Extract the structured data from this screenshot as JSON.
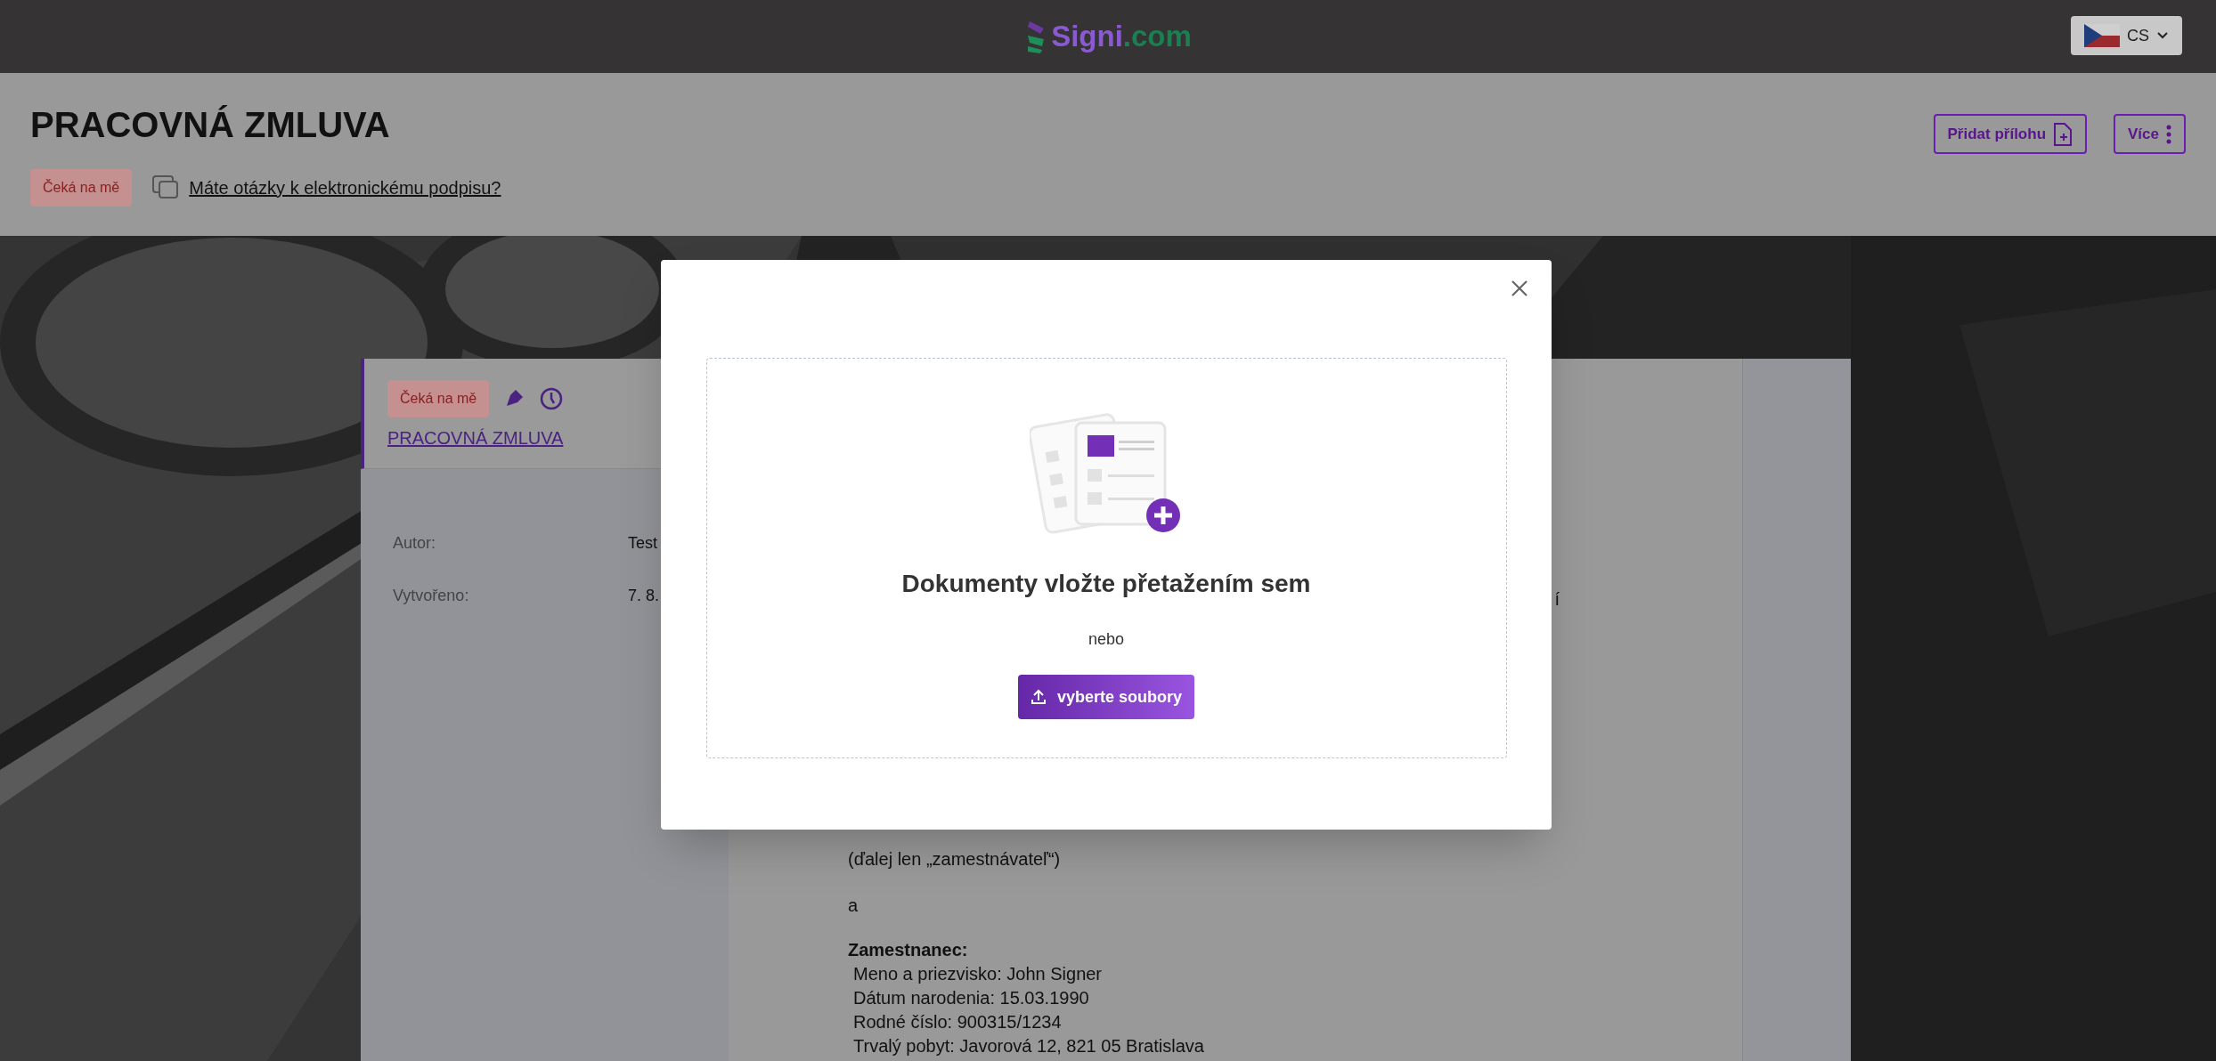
{
  "topbar": {
    "logo": {
      "name": "Signi",
      "suffix": ".com"
    },
    "language": {
      "code": "CS"
    }
  },
  "header": {
    "title": "PRACOVNÁ ZMLUVA",
    "status_badge": "Čeká na mě",
    "help_link": "Máte otázky k elektronickému podpisu?",
    "buttons": [
      {
        "label": "Přidat přílohu"
      },
      {
        "label": "Více"
      }
    ]
  },
  "document": {
    "status_badge": "Čeká na mě",
    "title_link": "PRACOVNÁ ZMLUVA",
    "details": [
      {
        "label": "Autor:",
        "value": "Test"
      },
      {
        "label": "Vytvořeno:",
        "value": "7. 8."
      }
    ],
    "text_fragment": "í",
    "paragraphs": [
      {
        "kind": "plain",
        "text": "(ďalej len „zamestnávateľ“)"
      },
      {
        "kind": "plain",
        "text": "a"
      },
      {
        "kind": "block",
        "heading": "Zamestnanec:",
        "lines": [
          "Meno a priezvisko: John Signer",
          "Dátum narodenia: 15.03.1990",
          "Rodné číslo: 900315/1234",
          "Trvalý pobyt: Javorová 12, 821 05 Bratislava"
        ]
      }
    ]
  },
  "modal": {
    "heading": "Dokumenty vložte přetažením sem",
    "separator": "nebo",
    "button": "vyberte soubory"
  }
}
